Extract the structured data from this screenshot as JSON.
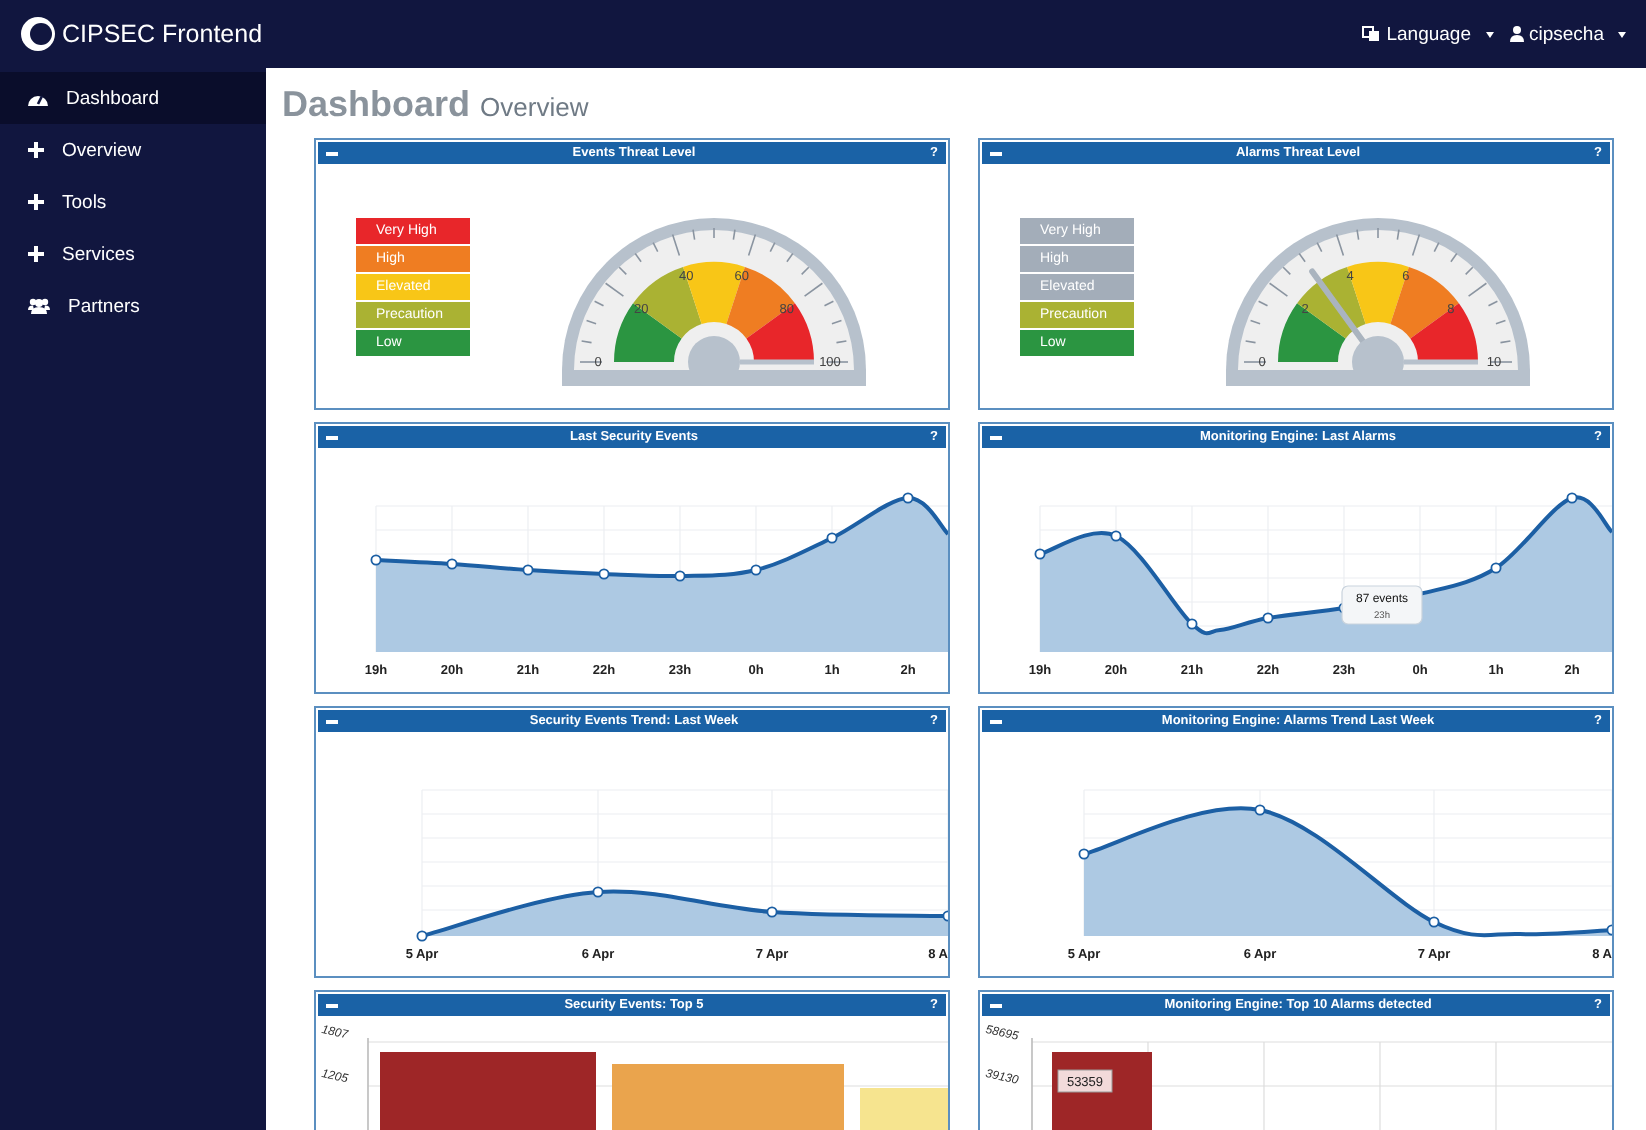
{
  "navbar": {
    "brand": "CIPSEC Frontend",
    "language": "Language",
    "user": "cipsecha"
  },
  "sidebar": {
    "items": [
      {
        "label": "Dashboard",
        "selected": true
      },
      {
        "label": "Overview",
        "selected": false
      },
      {
        "label": "Tools",
        "selected": false
      },
      {
        "label": "Services",
        "selected": false
      },
      {
        "label": "Partners",
        "selected": false
      }
    ]
  },
  "page_title": {
    "main": "Dashboard",
    "sub": "Overview"
  },
  "panels": [
    {
      "kind": "gauge",
      "title": "Events Threat Level",
      "help": "?",
      "legend": [
        {
          "label": "Very High",
          "color": "#e8262a",
          "active": true
        },
        {
          "label": "High",
          "color": "#ef7d22",
          "active": true
        },
        {
          "label": "Elevated",
          "color": "#f8c617",
          "active": true
        },
        {
          "label": "Precaution",
          "color": "#aab233",
          "active": true
        },
        {
          "label": "Low",
          "color": "#2b9541",
          "active": true
        }
      ],
      "dial_labels": [
        "0",
        "20",
        "40",
        "60",
        "80",
        "100"
      ]
    },
    {
      "kind": "gauge",
      "title": "Alarms Threat Level",
      "help": "?",
      "legend": [
        {
          "label": "Very High",
          "active": false
        },
        {
          "label": "High",
          "active": false
        },
        {
          "label": "Elevated",
          "active": false
        },
        {
          "label": "Precaution",
          "color": "#aab233",
          "active": true
        },
        {
          "label": "Low",
          "color": "#2b9541",
          "active": true
        }
      ],
      "dial_labels": [
        "0",
        "2",
        "4",
        "6",
        "8",
        "10"
      ]
    },
    {
      "kind": "line",
      "title": "Last Security Events",
      "help": "?",
      "x_labels": [
        "19h",
        "20h",
        "21h",
        "22h",
        "23h",
        "0h",
        "1h",
        "2h"
      ]
    },
    {
      "kind": "line",
      "title": "Monitoring Engine: Last Alarms",
      "help": "?",
      "x_labels": [
        "19h",
        "20h",
        "21h",
        "22h",
        "23h",
        "0h",
        "1h",
        "2h"
      ],
      "tooltip": {
        "value": "87 events",
        "label": "23h"
      }
    },
    {
      "kind": "line",
      "title": "Security Events Trend: Last Week",
      "help": "?",
      "x_labels": [
        "5 Apr",
        "6 Apr",
        "7 Apr",
        "8 A"
      ]
    },
    {
      "kind": "line",
      "title": "Monitoring Engine: Alarms Trend Last Week",
      "help": "?",
      "x_labels": [
        "5 Apr",
        "6 Apr",
        "7 Apr",
        "8 A"
      ]
    },
    {
      "kind": "bar",
      "title": "Security Events: Top 5",
      "help": "?",
      "y_labels": [
        "1807",
        "1205"
      ]
    },
    {
      "kind": "bar",
      "title": "Monitoring Engine: Top 10 Alarms detected",
      "help": "?",
      "y_labels": [
        "58695",
        "39130"
      ],
      "value_label": "53359"
    }
  ]
}
